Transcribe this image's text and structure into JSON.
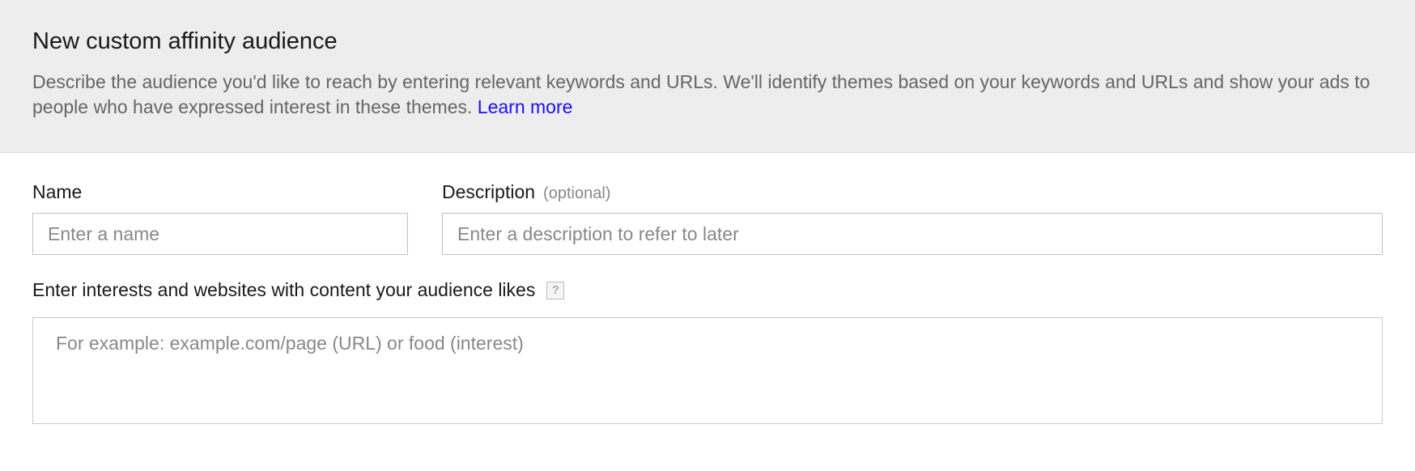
{
  "header": {
    "title": "New custom affinity audience",
    "description": "Describe the audience you'd like to reach by entering relevant keywords and URLs. We'll identify themes based on your keywords and URLs and show your ads to people who have expressed interest in these themes. ",
    "learn_more": "Learn more"
  },
  "form": {
    "name": {
      "label": "Name",
      "placeholder": "Enter a name",
      "value": ""
    },
    "description": {
      "label": "Description",
      "optional": "(optional)",
      "placeholder": "Enter a description to refer to later",
      "value": ""
    },
    "interests": {
      "label": "Enter interests and websites with content your audience likes",
      "help": "?",
      "placeholder": "For example: example.com/page (URL) or food (interest)",
      "value": ""
    }
  }
}
